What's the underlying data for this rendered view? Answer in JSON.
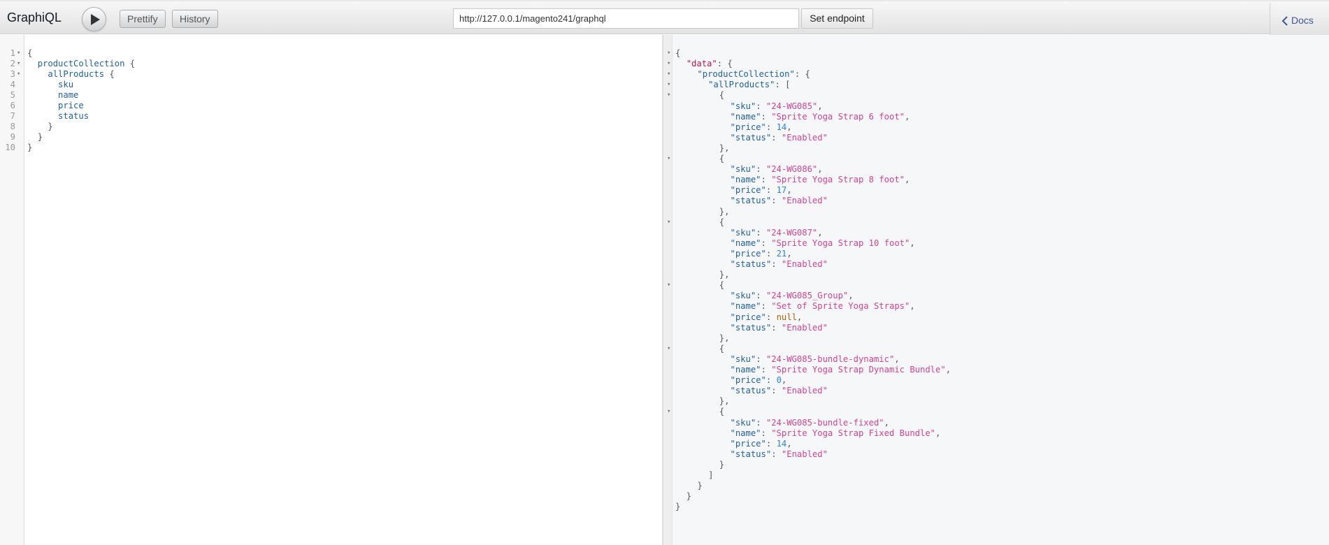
{
  "toolbar": {
    "title": "GraphiQL",
    "run_icon": "play-icon",
    "prettify_label": "Prettify",
    "history_label": "History",
    "endpoint_url": "http://127.0.0.1/magento241/graphql",
    "set_endpoint_label": "Set endpoint",
    "docs_label": "Docs",
    "docs_icon": "chevron-left-icon"
  },
  "query": {
    "lines": [
      {
        "n": "1",
        "fold": true,
        "indent": "",
        "text": "{",
        "field": false
      },
      {
        "n": "2",
        "fold": true,
        "indent": "  ",
        "text": "productCollection",
        "suffix": " {",
        "field": true
      },
      {
        "n": "3",
        "fold": true,
        "indent": "    ",
        "text": "allProducts",
        "suffix": " {",
        "field": true
      },
      {
        "n": "4",
        "fold": false,
        "indent": "      ",
        "text": "sku",
        "field": true
      },
      {
        "n": "5",
        "fold": false,
        "indent": "      ",
        "text": "name",
        "field": true
      },
      {
        "n": "6",
        "fold": false,
        "indent": "      ",
        "text": "price",
        "field": true
      },
      {
        "n": "7",
        "fold": false,
        "indent": "      ",
        "text": "status",
        "field": true
      },
      {
        "n": "8",
        "fold": false,
        "indent": "    ",
        "text": "}",
        "field": false
      },
      {
        "n": "9",
        "fold": false,
        "indent": "  ",
        "text": "}",
        "field": false
      },
      {
        "n": "10",
        "fold": false,
        "indent": "",
        "text": "}",
        "field": false
      }
    ]
  },
  "result": {
    "products": [
      {
        "sku": "24-WG085",
        "name": "Sprite Yoga Strap 6 foot",
        "price": "14",
        "status": "Enabled"
      },
      {
        "sku": "24-WG086",
        "name": "Sprite Yoga Strap 8 foot",
        "price": "17",
        "status": "Enabled"
      },
      {
        "sku": "24-WG087",
        "name": "Sprite Yoga Strap 10 foot",
        "price": "21",
        "status": "Enabled"
      },
      {
        "sku": "24-WG085_Group",
        "name": "Set of Sprite Yoga Straps",
        "price": "null",
        "status": "Enabled"
      },
      {
        "sku": "24-WG085-bundle-dynamic",
        "name": "Sprite Yoga Strap Dynamic Bundle",
        "price": "0",
        "status": "Enabled"
      },
      {
        "sku": "24-WG085-bundle-fixed",
        "name": "Sprite Yoga Strap Fixed Bundle",
        "price": "14",
        "status": "Enabled"
      }
    ]
  },
  "colors": {
    "field": "#1f61a0",
    "data_key": "#b11a4c",
    "string": "#d64292",
    "number": "#2882f9",
    "null": "#aa6600"
  }
}
